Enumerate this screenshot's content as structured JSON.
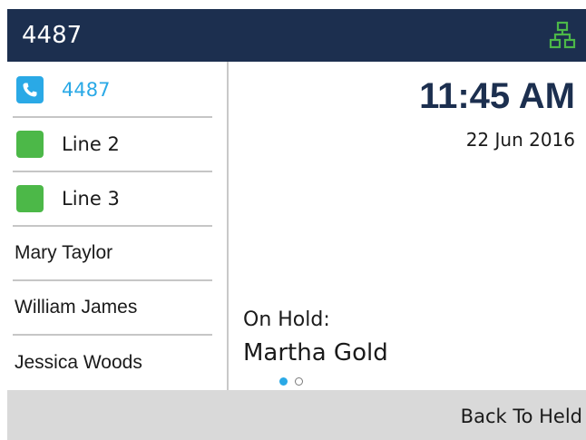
{
  "header": {
    "title": "4487",
    "status_icon": "network-icon",
    "status_color": "#4cb848"
  },
  "lines": [
    {
      "label": "4487",
      "icon": "phone-icon",
      "color": "#2aa9e6",
      "active": true
    },
    {
      "label": "Line 2",
      "icon": "line-status-icon",
      "color": "#4cb848",
      "active": false
    },
    {
      "label": "Line 3",
      "icon": "line-status-icon",
      "color": "#4cb848",
      "active": false
    }
  ],
  "contacts": [
    "Mary Taylor",
    "William James",
    "Jessica Woods"
  ],
  "clock": {
    "time": "11:45 AM",
    "date": "22 Jun 2016"
  },
  "hold": {
    "label": "On Hold:",
    "name": "Martha Gold"
  },
  "pager": {
    "pages": 2,
    "current": 1
  },
  "softkeys": {
    "back_to_held": "Back To Held"
  },
  "colors": {
    "header_bg": "#1c2f4f",
    "accent": "#2aa9e6",
    "line_green": "#4cb848",
    "softkey_bg": "#d9d9d9"
  }
}
